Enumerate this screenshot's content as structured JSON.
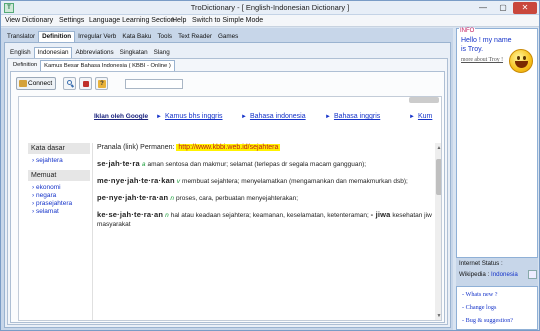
{
  "window": {
    "title": "TroDictionary - [ English-Indonesian Dictionary ]"
  },
  "menu": [
    "View Dictionary",
    "Settings",
    "Language Learning Section",
    "Help",
    "Switch to Simple Mode"
  ],
  "tabs_main": [
    "Translator",
    "Definition",
    "Irregular Verb",
    "Kata Baku",
    "Tools",
    "Text Reader",
    "Games"
  ],
  "tabs_lang": [
    "English",
    "Indonesian",
    "Abbreviations",
    "Singkatan",
    "Slang"
  ],
  "tabs_sub": [
    "Definition",
    "Kamus Besar Bahasa Indonesia ( KBBI - Online )"
  ],
  "toolbar": {
    "connect_label": "Connect"
  },
  "browser": {
    "ad_label": "Iklan oleh Google",
    "nav_links": [
      "Kamus bhs inggris",
      "Bahasa indonesia",
      "Bahasa inggris",
      "Kum"
    ],
    "sidebar": {
      "kata_dasar_head": "Kata dasar",
      "kata_dasar_items": [
        "sejahtera"
      ],
      "memuat_head": "Memuat",
      "memuat_items": [
        "ekonomi",
        "negara",
        "prasejahtera",
        "selamat"
      ]
    },
    "permalink_label": "Pranala (link) Permanen:",
    "permalink_url": "http://www.kbbi.web.id/sejahtera",
    "entries": [
      {
        "word": "se·jah·te·ra",
        "pos": "a",
        "def": "aman sentosa dan makmur; selamat (terlepas dr segala macam gangguan);"
      },
      {
        "word": "me·nye·jah·te·ra·kan",
        "pos": "v",
        "def": "membuat sejahtera; menyelamatkan (mengamankan dan memakmurkan dsb);"
      },
      {
        "word": "pe·nye·jah·te·ra·an",
        "pos": "n",
        "def": "proses, cara, perbuatan menyejahterakan;"
      },
      {
        "word": "ke·se·jah·te·ra·an",
        "pos": "n",
        "def": "hal atau keadaan sejahtera; keamanan, keselamatan, ketenteraman;",
        "word2": "- jiwa",
        "def2": "kesehatan jiw masyarakat"
      }
    ]
  },
  "info": {
    "label": "INFO",
    "hello": "Hello ! my name is Troy.",
    "more_link": "more about Troy !"
  },
  "status": {
    "internet_label": "Internet Status :",
    "wikipedia_label": "Wikipedia :",
    "wikipedia_lang": "Indonesia"
  },
  "links": [
    "- Whats new ?",
    "- Change logs",
    "- Bug & suggestion?"
  ],
  "colors": {
    "accent_blue": "#1533c9",
    "pos_green": "#1a9e3a",
    "url_red": "#c01a1a",
    "highlight": "#fff200",
    "info_label": "#c2185b"
  }
}
